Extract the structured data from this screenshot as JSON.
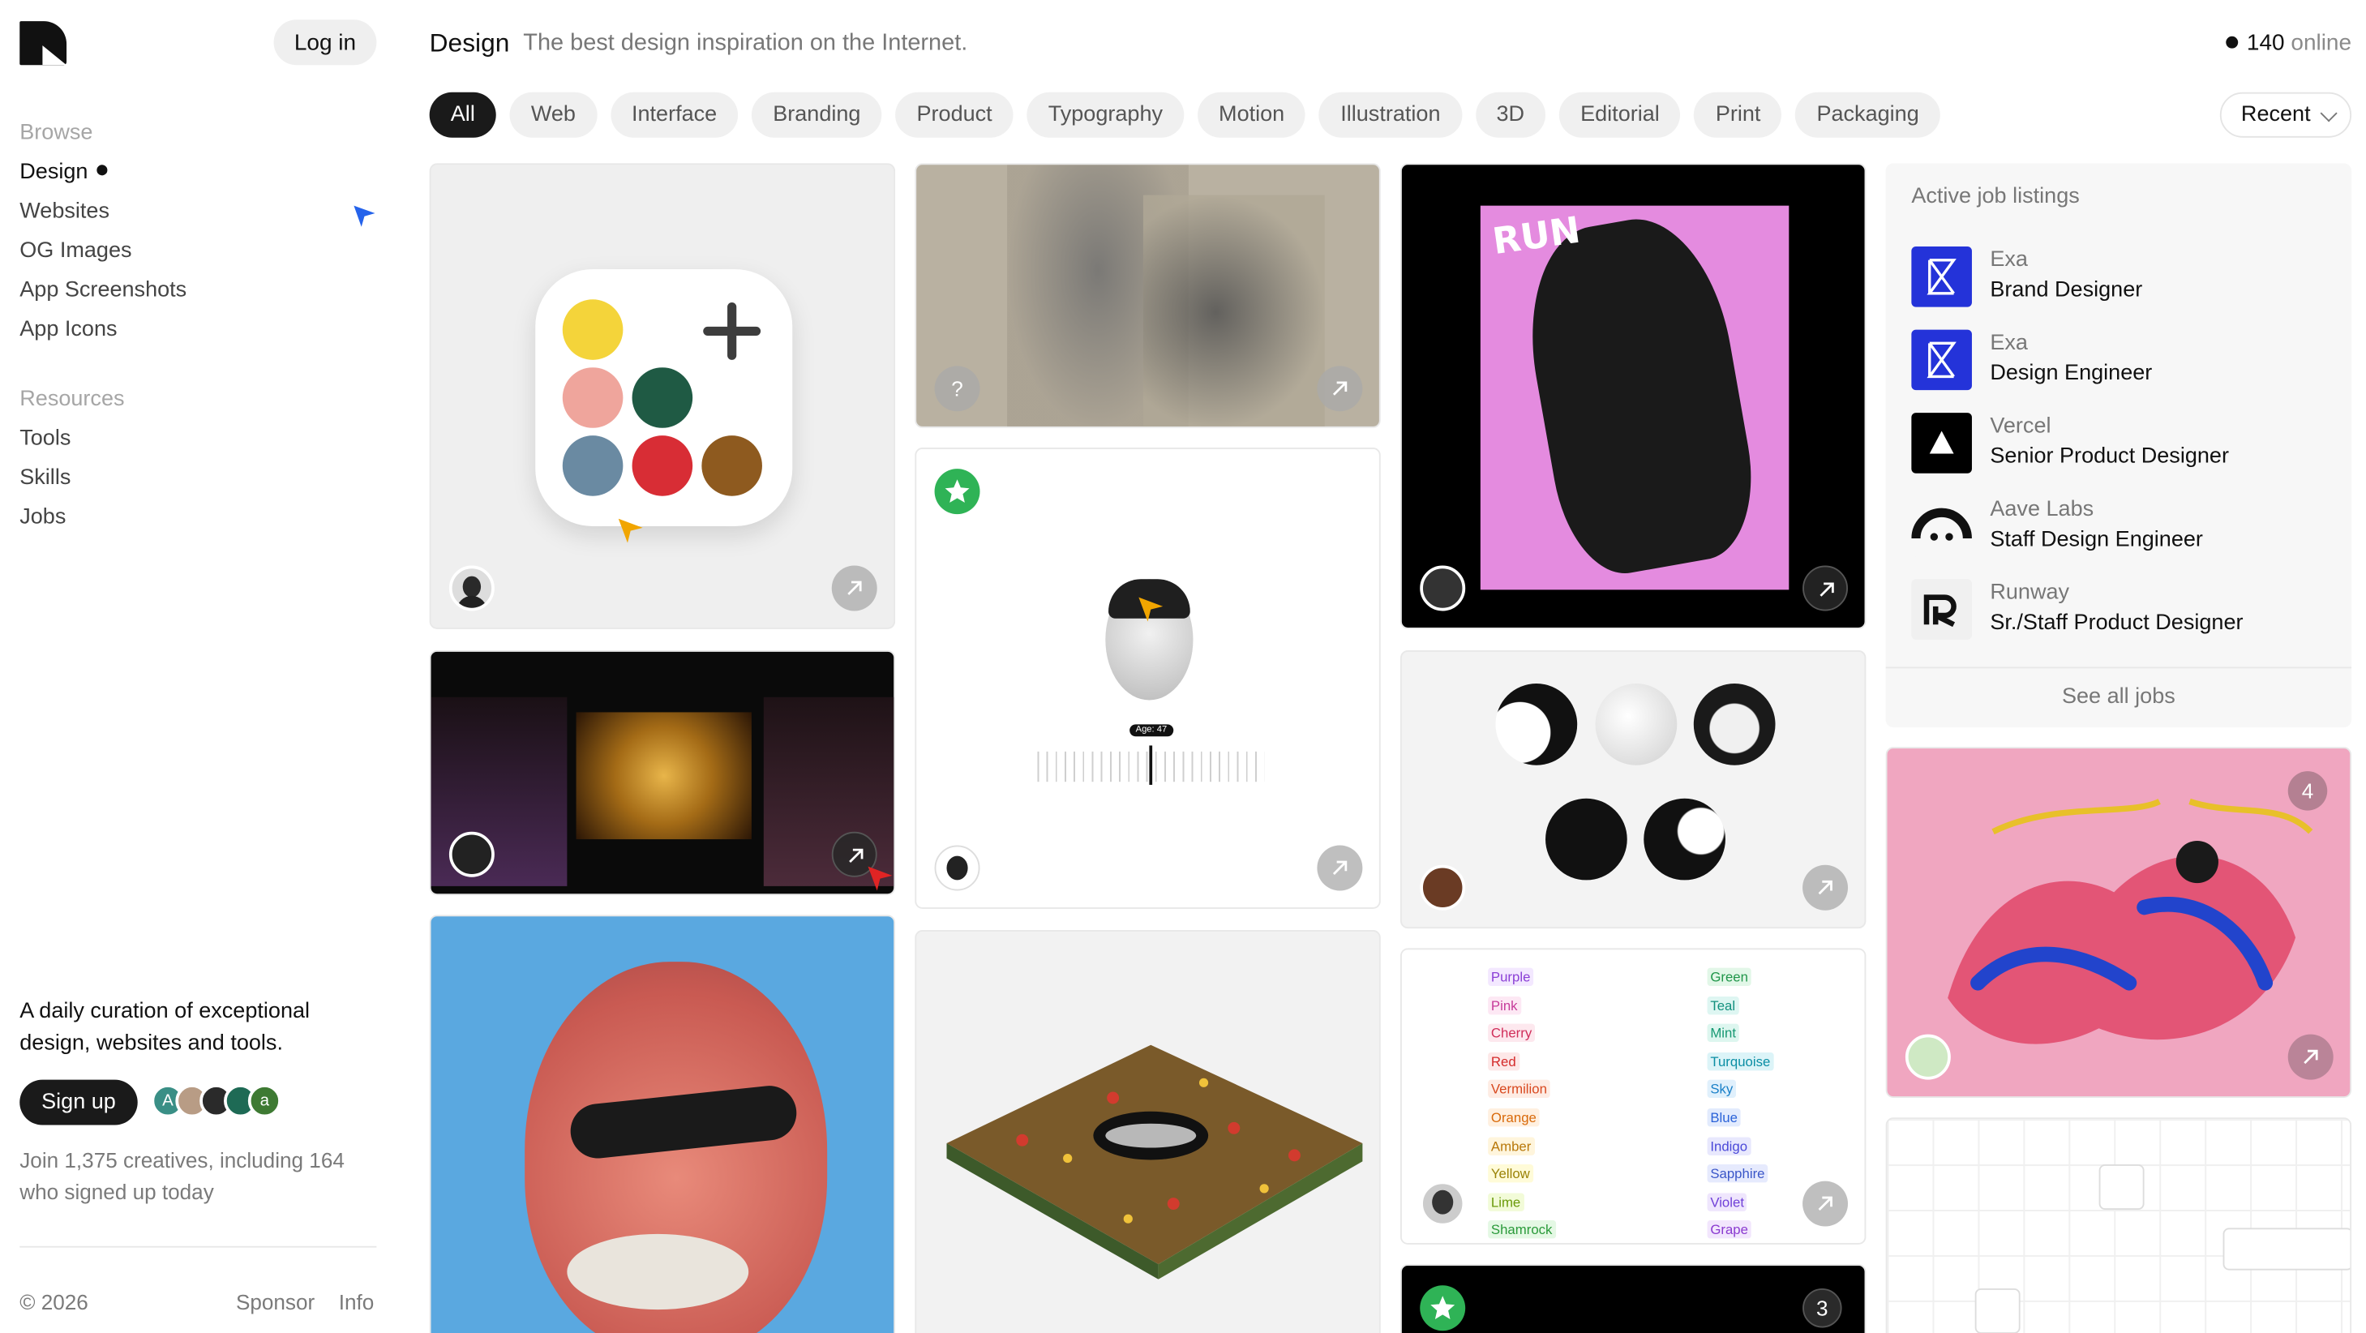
{
  "sidebar": {
    "login": "Log in",
    "browse_header": "Browse",
    "browse": [
      "Design",
      "Websites",
      "OG Images",
      "App Screenshots",
      "App Icons"
    ],
    "resources_header": "Resources",
    "resources": [
      "Tools",
      "Skills",
      "Jobs"
    ],
    "tagline": "A daily curation of exceptional design, websites and tools.",
    "signup": "Sign up",
    "avatars": [
      "A",
      "",
      "",
      "",
      "a"
    ],
    "join_text": "Join 1,375 creatives, including 164 who signed up today",
    "copyright": "© 2026",
    "sponsor": "Sponsor",
    "info": "Info"
  },
  "header": {
    "title": "Design",
    "subtitle": "The best design inspiration on the Internet.",
    "online_count": "140",
    "online_label": "online"
  },
  "filters": [
    "All",
    "Web",
    "Interface",
    "Branding",
    "Product",
    "Typography",
    "Motion",
    "Illustration",
    "3D",
    "Editorial",
    "Print",
    "Packaging"
  ],
  "sort": "Recent",
  "jobs": {
    "header": "Active job listings",
    "items": [
      {
        "company": "Exa",
        "title": "Brand Designer"
      },
      {
        "company": "Exa",
        "title": "Design Engineer"
      },
      {
        "company": "Vercel",
        "title": "Senior Product Designer"
      },
      {
        "company": "Aave Labs",
        "title": "Staff Design Engineer"
      },
      {
        "company": "Runway",
        "title": "Sr./Staff Product Designer"
      }
    ],
    "see_all": "See all jobs"
  },
  "cards": {
    "help_mark": "?",
    "age_label": "Age: 47",
    "poster_word": "RUN",
    "badge_illustration": "4",
    "badge_dark": "3",
    "swatches_left": [
      "Purple",
      "Pink",
      "Cherry",
      "Red",
      "Vermilion",
      "Orange",
      "Amber",
      "Yellow",
      "Lime",
      "Shamrock"
    ],
    "swatches_right": [
      "Green",
      "Teal",
      "Mint",
      "Turquoise",
      "Sky",
      "Blue",
      "Indigo",
      "Sapphire",
      "Violet",
      "Grape"
    ]
  },
  "colors": {
    "exa": "#2433d9",
    "star": "#2fb356",
    "accent": "#1a1a1a"
  }
}
